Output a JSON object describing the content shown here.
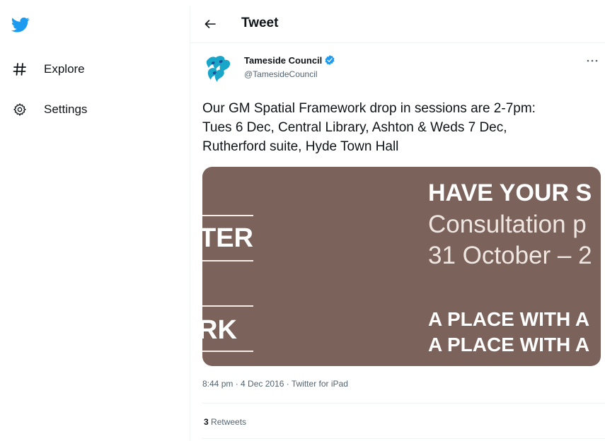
{
  "sidebar": {
    "logo_icon": "twitter-bird-icon",
    "items": [
      {
        "label": "Explore",
        "icon": "hashtag-icon"
      },
      {
        "label": "Settings",
        "icon": "gear-icon"
      }
    ]
  },
  "header": {
    "back_icon": "arrow-left-icon",
    "title": "Tweet"
  },
  "tweet": {
    "author_name": "Tameside Council",
    "author_handle": "@TamesideCouncil",
    "verified": true,
    "more_icon": "more-horizontal-icon",
    "text": "Our GM Spatial Framework drop in sessions are 2-7pm:\nTues 6 Dec, Central Library, Ashton & Weds 7 Dec,\nRutherford suite, Hyde Town Hall",
    "media": {
      "left_fragment_top": "TER",
      "left_fragment_bottom": "RK",
      "heading": "HAVE YOUR S",
      "line_1": "Consultation p",
      "line_2": "31 October – 2",
      "tagline_1": "A PLACE WITH A",
      "tagline_2": "A PLACE WITH A"
    },
    "timestamp": "8:44 pm · 4 Dec 2016 · Twitter for iPad",
    "retweet_count": "3",
    "retweet_label": "Retweets"
  },
  "colors": {
    "accent": "#1d9bf0",
    "media_bg": "#7b625a",
    "text_primary": "#0f1419",
    "text_secondary": "#536471"
  }
}
